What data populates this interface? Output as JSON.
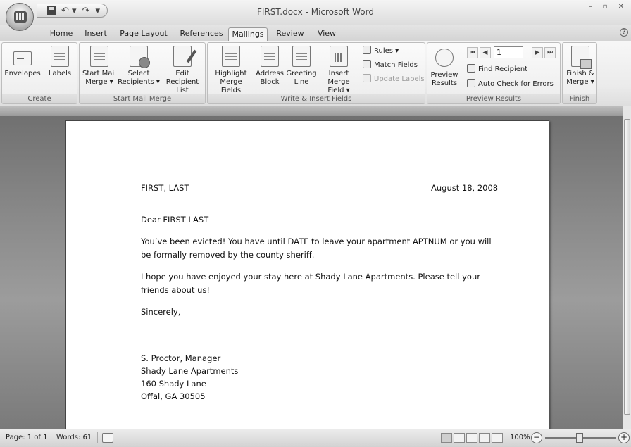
{
  "window": {
    "title": "FIRST.docx - Microsoft Word"
  },
  "tabs": [
    "Home",
    "Insert",
    "Page Layout",
    "References",
    "Mailings",
    "Review",
    "View"
  ],
  "active_tab": "Mailings",
  "ribbon": {
    "create": {
      "label": "Create",
      "envelopes": "Envelopes",
      "labels": "Labels"
    },
    "start_mail_merge": {
      "label": "Start Mail Merge",
      "start_mail_merge": [
        "Start Mail",
        "Merge ▾"
      ],
      "select_recipients": [
        "Select",
        "Recipients ▾"
      ],
      "edit_recipient_list": [
        "Edit",
        "Recipient List"
      ]
    },
    "write_insert": {
      "label": "Write & Insert Fields",
      "highlight": [
        "Highlight",
        "Merge Fields"
      ],
      "address_block": [
        "Address",
        "Block"
      ],
      "greeting_line": [
        "Greeting",
        "Line"
      ],
      "insert_merge_field": [
        "Insert Merge",
        "Field ▾"
      ],
      "rules": "Rules ▾",
      "match_fields": "Match Fields",
      "update_labels": "Update Labels"
    },
    "preview_results": {
      "label": "Preview Results",
      "preview": [
        "Preview",
        "Results"
      ],
      "record": "1",
      "find_recipient": "Find Recipient",
      "auto_check": "Auto Check for Errors"
    },
    "finish": {
      "label": "Finish",
      "finish_merge": [
        "Finish &",
        "Merge ▾"
      ]
    }
  },
  "document": {
    "name_line": "FIRST, LAST",
    "date": "August 18, 2008",
    "salutation": "Dear FIRST LAST",
    "para1": [
      "You’ve been evicted! You have until DATE to leave your apartment APTNUM or you will",
      "be formally removed by the county sheriff."
    ],
    "para2": [
      "I hope you have enjoyed your stay here at Shady Lane Apartments. Please tell your",
      "friends about us!"
    ],
    "closing": "Sincerely,",
    "signature": [
      "S. Proctor, Manager",
      "Shady Lane Apartments",
      "160 Shady Lane",
      "Offal, GA 30505"
    ]
  },
  "statusbar": {
    "page": "Page: 1 of 1",
    "words": "Words: 61",
    "zoom": "100%"
  },
  "icons": {
    "office_button": "office-logo-icon",
    "save": "save-icon",
    "undo": "undo-icon",
    "redo": "redo-icon",
    "proofing": "proofing-icon",
    "zoom_out": "zoom-out-icon",
    "zoom_in": "zoom-in-icon"
  }
}
